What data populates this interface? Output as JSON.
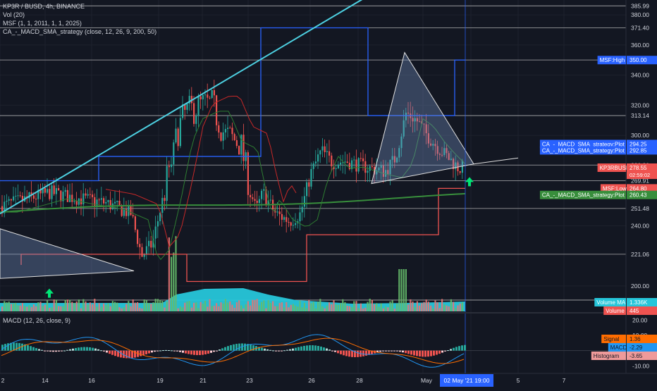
{
  "header": {
    "symbol_line": "KP3R / BUSD, 4h, BINANCE",
    "vol_line": "Vol (20)",
    "msf_line": "MSF (1, 1, 2011, 1, 1, 2025)",
    "strategy_line": "CA_-_MACD_SMA_strategy (close, 12, 26, 9, 200, 50)"
  },
  "macd_panel": {
    "title": "MACD (12, 26, close, 9)"
  },
  "price_axis": {
    "ticks": [
      "385.99",
      "380.00",
      "371.40",
      "360.00",
      "350.04",
      "340.00",
      "320.00",
      "313.14",
      "300.00",
      "280.30",
      "269.91",
      "251.48",
      "240.00",
      "221.06",
      "200.00",
      "190.64"
    ],
    "tags": [
      {
        "label": "MSF:High",
        "value": "350.00",
        "color": "#2962ff"
      },
      {
        "label": "CA_-_MACD_SMA_strategy:Plot",
        "value": "294.25",
        "color": "#2962ff"
      },
      {
        "label": "CA_-_MACD_SMA_strategy:Plot",
        "value": "292.85",
        "color": "#2962ff"
      },
      {
        "label": "KP3RBUSD",
        "value": "278.55",
        "sub": "02:59:02",
        "color": "#ef5350"
      },
      {
        "label": "MSF:Low",
        "value": "264.80",
        "color": "#ef5350"
      },
      {
        "label": "CA_-_MACD_SMA_strategy:Plot",
        "value": "260.43",
        "color": "#388e3c"
      },
      {
        "label": "Volume MA",
        "value": "1.336K",
        "color": "#26c6da"
      },
      {
        "label": "Volume",
        "value": "445",
        "color": "#ef5350"
      }
    ]
  },
  "macd_axis": {
    "ticks": [
      "20.00",
      "10.00",
      "0.00",
      "-10.00"
    ],
    "tags": [
      {
        "label": "Signal",
        "value": "1.36",
        "color": "#ff6d00"
      },
      {
        "label": "MACD",
        "value": "-2.29",
        "color": "#2196f3"
      },
      {
        "label": "Histogram",
        "value": "-3.65",
        "color": "#ef9a9a"
      }
    ]
  },
  "time_axis": {
    "labels": [
      "2",
      "14",
      "16",
      "19",
      "21",
      "23",
      "26",
      "28",
      "May",
      "3",
      "5",
      "7"
    ],
    "cursor_label": "02 May '21   19:00"
  },
  "colors": {
    "background": "#131722",
    "up": "#26a69a",
    "down": "#ef5350",
    "volume_ma": "#26c6da",
    "msf": "#2962ff",
    "sma_long": "#388e3c",
    "trendline": "#4dd0e1"
  },
  "chart_data": {
    "type": "candlestick",
    "title": "KP3R / BUSD, 4h, BINANCE",
    "ylim": [
      185,
      388
    ],
    "horizontal_levels": [
      385.99,
      371.4,
      350.04,
      313.14,
      280.3,
      269.91,
      251.48,
      221.06,
      190.64
    ],
    "x_labels": [
      "2",
      "14",
      "16",
      "19",
      "21",
      "23",
      "26",
      "28",
      "May",
      "3",
      "5",
      "7"
    ],
    "price": {
      "last": 278.55,
      "high_marker": 350.04,
      "low_marker": 190.64
    },
    "msf": {
      "high": 350.0,
      "low": 264.8
    },
    "strategy_plots": [
      294.25,
      292.85,
      260.43
    ],
    "volume": {
      "ma": "1.336K",
      "last": "445"
    },
    "macd": {
      "params": "12, 26, close, 9",
      "signal": 1.36,
      "macd": -2.29,
      "histogram": -3.65,
      "ylim": [
        -14,
        22
      ]
    }
  }
}
